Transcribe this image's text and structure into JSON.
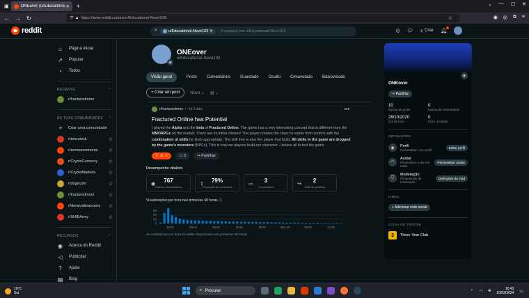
{
  "browser": {
    "tab_title": "ONEover (u/Educational-Neve103/)",
    "url": "https://www.reddit.com/user/Educational-Neve103/"
  },
  "header": {
    "logo_text": "reddit",
    "search_chip": "u/Educational-Neve103",
    "search_placeholder": "Pesquisar em u/Educational-Neve103",
    "create_label": "Criar"
  },
  "sidebar": {
    "nav": [
      {
        "label": "Página inicial",
        "icon": "home-icon"
      },
      {
        "label": "Popular",
        "icon": "popular-icon"
      },
      {
        "label": "Todos",
        "icon": "all-icon"
      }
    ],
    "recent_title": "RECENTE",
    "recent": [
      {
        "label": "r/fracturedmmo",
        "color": "#6b8f3c"
      }
    ],
    "communities_title": "AS TUAS COMUNIDADES",
    "create_community": "Criar uma comunidade",
    "communities": [
      {
        "label": "r/amcstock",
        "color": "#d93a2a"
      },
      {
        "label": "r/announcements",
        "color": "#ff4500"
      },
      {
        "label": "r/CryptoCurrency",
        "color": "#e8501c"
      },
      {
        "label": "r/CryptoMarkets",
        "color": "#2f5fd0"
      },
      {
        "label": "r/dogecoin",
        "color": "#c9a83b"
      },
      {
        "label": "r/fracturedmmo",
        "color": "#6b8f3c"
      },
      {
        "label": "r/literaciafinanceira",
        "color": "#ff4500"
      },
      {
        "label": "r/SHIBArmy",
        "color": "#e0372b"
      }
    ],
    "resources_title": "RECURSOS",
    "resources": [
      {
        "label": "Acerca do Reddit",
        "icon": "reddit-icon"
      },
      {
        "label": "Publicitar",
        "icon": "megaphone-icon"
      },
      {
        "label": "Ajuda",
        "icon": "help-icon"
      },
      {
        "label": "Blog",
        "icon": "book-icon"
      }
    ]
  },
  "profile": {
    "display_name": "ONEover",
    "username": "u/Educational-Neve103",
    "tabs": [
      "Visão geral",
      "Posts",
      "Comentários",
      "Guardado",
      "Oculto",
      "Cimavotado",
      "Baixovotado"
    ],
    "create_post": "Criar um post",
    "sort_label": "Novo"
  },
  "post": {
    "subreddit": "r/fracturedmmo",
    "time": "há 2 dias",
    "title": "Fractured Online has Potential",
    "body_parts": [
      {
        "t": "I played the ",
        "b": false
      },
      {
        "t": "Alpha",
        "b": true
      },
      {
        "t": " and the ",
        "b": false
      },
      {
        "t": "beta",
        "b": true
      },
      {
        "t": " of ",
        "b": false
      },
      {
        "t": "Fractured Online",
        "b": true
      },
      {
        "t": ". The game has a very interesting concept that is different from the ",
        "b": false
      },
      {
        "t": "MMORPGs",
        "b": true
      },
      {
        "t": " on the market. There are no initial classes! The player creates the class he wants from scratch with the ",
        "b": false
      },
      {
        "t": "combination of skills",
        "b": true
      },
      {
        "t": " he finds appropriate. The skill tree is also the player that build. ",
        "b": false
      },
      {
        "t": "All skills in the game are dropped by the game's monsters",
        "b": true
      },
      {
        "t": " (NPCs). This is how we players build our character. I advise all to test the game",
        "b": false
      }
    ],
    "votes": "8",
    "comments": "3",
    "share": "Partilhar"
  },
  "performance": {
    "title": "Desempenho vitalício",
    "stats": [
      {
        "value": "767",
        "label": "Total de visualizações",
        "icon": "eye-icon"
      },
      {
        "value": "79%",
        "label": "Proporção de cimavotos",
        "icon": "upvote-icon"
      },
      {
        "value": "3",
        "label": "Comentários",
        "icon": "comment-icon"
      },
      {
        "value": "2",
        "label": "Total de partilhas",
        "icon": "share-icon"
      }
    ],
    "chart_title": "Visualizações por hora nas primeiras 48 horas",
    "note": "As estatísticas por hora só estão disponíveis nas primeiras 48 horas"
  },
  "chart_data": {
    "type": "bar",
    "title": "Visualizações por hora nas primeiras 48 horas",
    "xlabel": "",
    "ylabel": "",
    "ylim": [
      0,
      80
    ],
    "y_ticks": [
      0,
      20,
      40,
      60
    ],
    "x_tick_labels": [
      "18:00",
      "Mar 9",
      "06:00",
      "12:00",
      "18:00",
      "Mar 10",
      "06:00",
      "12:00"
    ],
    "x_tick_positions": [
      3,
      9,
      15,
      21,
      27,
      33,
      39,
      45
    ],
    "values": [
      5,
      48,
      70,
      38,
      29,
      22,
      18,
      16,
      15,
      14,
      14,
      13,
      12,
      12,
      11,
      11,
      10,
      10,
      9,
      9,
      9,
      8,
      8,
      7,
      7,
      7,
      6,
      6,
      6,
      5,
      5,
      5,
      5,
      4,
      4,
      4,
      4,
      3,
      3,
      3,
      3,
      3,
      2,
      2,
      2,
      2,
      2,
      1
    ],
    "bar_color": "#0079d3"
  },
  "right_panel": {
    "name": "ONEover",
    "share": "Partilhar",
    "karma": [
      {
        "value": "10",
        "label": "Karma de posts"
      },
      {
        "value": "0",
        "label": "Karma de comentários"
      },
      {
        "value": "28/10/2020",
        "label": "Dia de bolo"
      },
      {
        "value": "0",
        "label": "Ouro recebido"
      }
    ],
    "settings_title": "DEFINIÇÕES",
    "settings": [
      {
        "title": "Perfil",
        "desc": "Personalizar o teu perfil",
        "button": "Editar perfil"
      },
      {
        "title": "Avatar",
        "desc": "Personalizar e dar um estilo",
        "button": "Personalizar avatar"
      },
      {
        "title": "Moderação",
        "desc": "Ferramentas de moderação",
        "button": "Definições de mod"
      }
    ],
    "links_title": "LINKS",
    "add_social": "Adicionar rede social",
    "trophy_title": "CAIXA DE TROFÉU",
    "trophy": "Three-Year Club"
  },
  "taskbar": {
    "temp": "16°C",
    "weather": "Sol",
    "search": "Procurar",
    "time": "16:43",
    "date": "10/03/2024"
  }
}
